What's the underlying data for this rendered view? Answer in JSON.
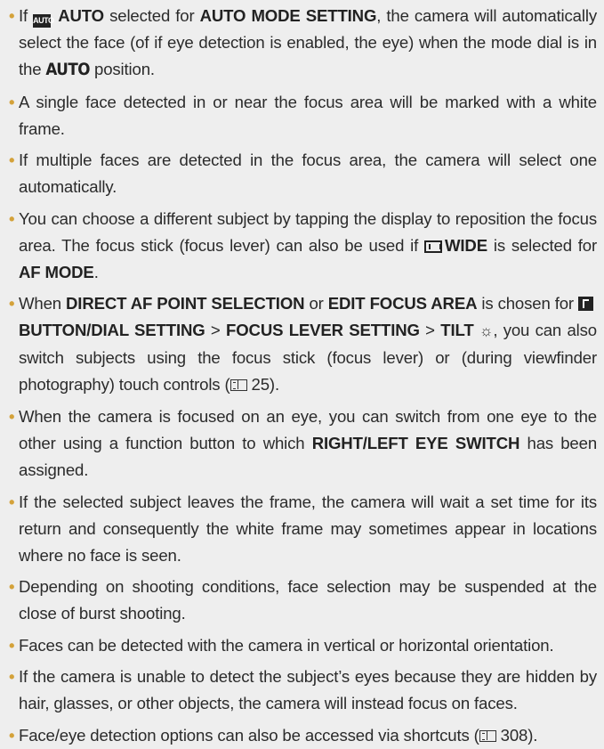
{
  "notes": [
    {
      "parts": [
        {
          "t": "If "
        },
        {
          "icon": "auto-mode-icon",
          "label": "AUTO"
        },
        {
          "t": " "
        },
        {
          "b": "AUTO"
        },
        {
          "t": " selected for "
        },
        {
          "b": "AUTO MODE SETTING"
        },
        {
          "t": ", the camera will automatically select the face (of if eye detection is enabled, the eye) when the mode dial is in the "
        },
        {
          "b": "AUTO",
          "cond": true
        },
        {
          "t": " position."
        }
      ]
    },
    {
      "parts": [
        {
          "t": "A single face detected in or near the focus area will be marked with a white frame."
        }
      ]
    },
    {
      "parts": [
        {
          "t": "If multiple faces are detected in the focus area, the camera will select one automatically."
        }
      ]
    },
    {
      "parts": [
        {
          "t": "You can choose a different subject by tapping the display to reposition the focus area. The focus stick (focus lever) can also be used if "
        },
        {
          "icon": "wide-af-icon"
        },
        {
          "b": "WIDE"
        },
        {
          "t": " is selected for "
        },
        {
          "b": "AF MODE"
        },
        {
          "t": "."
        }
      ]
    },
    {
      "parts": [
        {
          "t": "When "
        },
        {
          "b": "DIRECT AF POINT SELECTION"
        },
        {
          "t": " or "
        },
        {
          "b": "EDIT FOCUS AREA"
        },
        {
          "t": " is chosen for "
        },
        {
          "icon": "fn-button-icon"
        },
        {
          "b": "BUTTON/DIAL SETTING"
        },
        {
          "t": " > "
        },
        {
          "b": "FOCUS LEVER SETTING"
        },
        {
          "t": " > "
        },
        {
          "b": "TILT"
        },
        {
          "t": " "
        },
        {
          "icon": "tilt-icon"
        },
        {
          "t": ", you can also switch subjects using the focus stick (focus lever) or (during viewfinder photography) touch controls ("
        },
        {
          "icon": "page-ref-icon"
        },
        {
          "t": "25)."
        }
      ]
    },
    {
      "parts": [
        {
          "t": "When the camera is focused on an eye, you can switch from one eye to the other using a function button to which "
        },
        {
          "b": "RIGHT/LEFT EYE SWITCH"
        },
        {
          "t": " has been assigned."
        }
      ]
    },
    {
      "parts": [
        {
          "t": "If the selected subject leaves the frame, the camera will wait a set time for its return and consequently the white frame may sometimes appear in locations where no face is seen."
        }
      ]
    },
    {
      "parts": [
        {
          "t": "Depending on shooting conditions, face selection may be suspended at the close of burst shooting."
        }
      ]
    },
    {
      "parts": [
        {
          "t": "Faces can be detected with the camera in vertical or horizontal orientation."
        }
      ]
    },
    {
      "parts": [
        {
          "t": "If the camera is unable to detect the subject’s eyes because they are hidden by hair, glasses, or other objects, the camera will instead focus on faces."
        }
      ]
    },
    {
      "parts": [
        {
          "t": "Face/eye detection options can also be accessed via shortcuts ("
        },
        {
          "icon": "page-ref-icon"
        },
        {
          "t": "308)."
        }
      ]
    }
  ]
}
